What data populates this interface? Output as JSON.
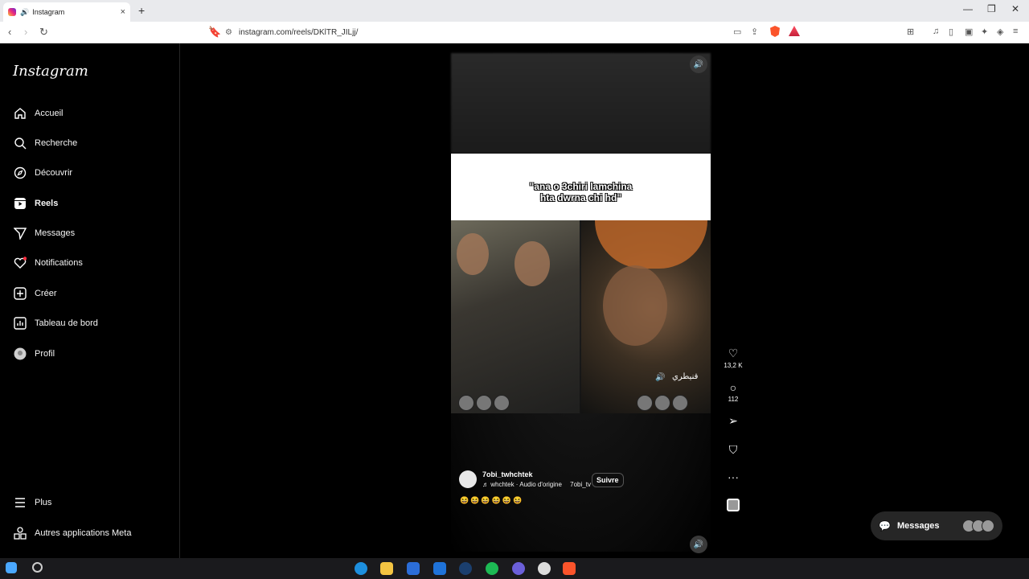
{
  "browser": {
    "tab_title": "Instagram",
    "new_tab": "+",
    "tab_close": "×",
    "url": "instagram.com/reels/DKlTR_JILjj/",
    "window_controls": [
      "—",
      "❐",
      "✕"
    ]
  },
  "sidebar": {
    "logo": "Instagram",
    "items": [
      {
        "label": "Accueil",
        "icon": "home-icon"
      },
      {
        "label": "Recherche",
        "icon": "search-icon"
      },
      {
        "label": "Découvrir",
        "icon": "compass-icon"
      },
      {
        "label": "Reels",
        "icon": "reels-icon"
      },
      {
        "label": "Messages",
        "icon": "send-icon"
      },
      {
        "label": "Notifications",
        "icon": "heart-icon"
      },
      {
        "label": "Créer",
        "icon": "plus-square-icon"
      },
      {
        "label": "Tableau de bord",
        "icon": "bar-chart-icon"
      },
      {
        "label": "Profil",
        "icon": "avatar-icon"
      }
    ],
    "bottom": [
      {
        "label": "Plus",
        "icon": "menu-icon"
      },
      {
        "label": "Autres applications Meta",
        "icon": "meta-apps-icon"
      }
    ]
  },
  "reel": {
    "caption_line1": "\"ana o 3chiri lamchina",
    "caption_line2": "hta dwrna chi hd\"",
    "overlay_text": "قنيطري",
    "author": "7obi_twhchtek",
    "audio": "♬ whchtek · Audio d'origine",
    "audio_suffix": "7obi_tv",
    "follow": "Suivre",
    "description": "😆😆😆😆😆😆"
  },
  "actions": {
    "likes": "13,2 K",
    "comments": "112",
    "more": "···"
  },
  "messages_pill": {
    "label": "Messages"
  }
}
